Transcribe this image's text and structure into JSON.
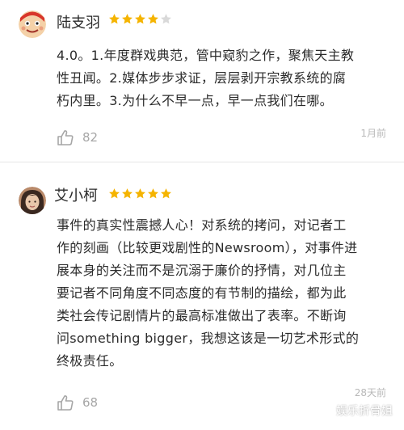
{
  "reviews": [
    {
      "user": "陆支羽",
      "rating": 4,
      "max_rating": 5,
      "text_lines": [
        "4.0。1.年度群戏典范，管中窥豹之作，聚焦天主教",
        "性丑闻。2.媒体步步求证，层层剥开宗教系统的腐",
        "朽内里。3.为什么不早一点，早一点我们在哪。"
      ],
      "likes": "82",
      "time": "1月前",
      "avatar_icon": "cartoon-face-avatar"
    },
    {
      "user": "艾小柯",
      "rating": 5,
      "max_rating": 5,
      "text_lines": [
        "事件的真实性震撼人心！对系统的拷问，对记者工",
        "作的刻画（比较更戏剧性的Newsroom），对事件进",
        "展本身的关注而不是沉溺于廉价的抒情，对几位主",
        "要记者不同角度不同态度的有节制的描绘，都为此",
        "类社会传记剧情片的最高标准做出了表率。不断询",
        "问something bigger，我想这该是一切艺术形式的",
        "终极责任。"
      ],
      "likes": "68",
      "time": "28天前",
      "avatar_icon": "photo-avatar"
    }
  ],
  "watermark": {
    "text": "娱乐折骨姐",
    "icon": "wechat-icon"
  },
  "colors": {
    "star_on": "#f5b400",
    "star_off": "#d9d9d9",
    "meta_gray": "#a6a6a6"
  }
}
